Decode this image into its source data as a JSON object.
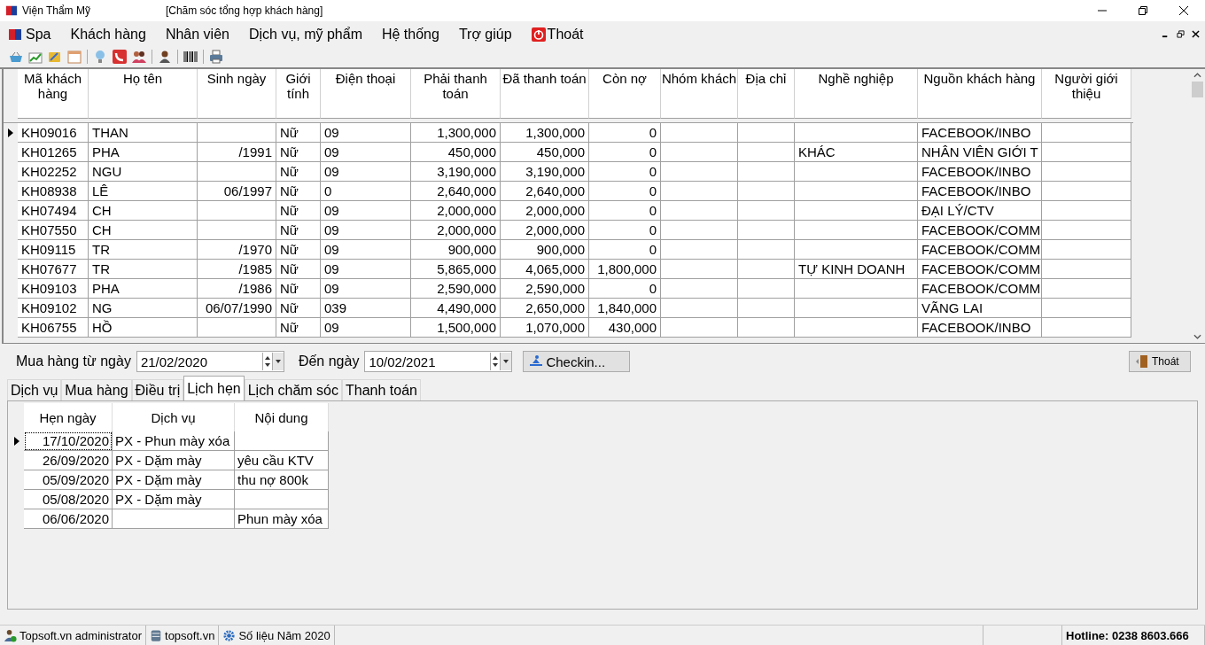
{
  "window": {
    "title": "Viện Thẩm Mỹ",
    "subtitle": "[Chăm sóc tổng hợp khách hàng]"
  },
  "menu": [
    {
      "label": "Spa",
      "kind": "logo"
    },
    {
      "label": "Khách hàng",
      "kind": "plain"
    },
    {
      "label": "Nhân viên",
      "kind": "plain"
    },
    {
      "label": "Dịch vụ, mỹ phẩm",
      "kind": "plain"
    },
    {
      "label": "Hệ thống",
      "kind": "plain"
    },
    {
      "label": "Trợ giúp",
      "kind": "plain"
    },
    {
      "label": "Thoát",
      "kind": "exit"
    }
  ],
  "table": {
    "columns": [
      {
        "label": "Mã khách hàng",
        "kind": "text"
      },
      {
        "label": "Họ tên",
        "kind": "text"
      },
      {
        "label": "Sinh ngày",
        "kind": "number"
      },
      {
        "label": "Giới tính",
        "kind": "text"
      },
      {
        "label": "Điện thoại",
        "kind": "text"
      },
      {
        "label": "Phải thanh toán",
        "kind": "number"
      },
      {
        "label": "Đã thanh toán",
        "kind": "number"
      },
      {
        "label": "Còn nợ",
        "kind": "number"
      },
      {
        "label": "Nhóm khách",
        "kind": "text"
      },
      {
        "label": "Địa chỉ",
        "kind": "text"
      },
      {
        "label": "Nghề nghiệp",
        "kind": "text"
      },
      {
        "label": "Nguồn khách hàng",
        "kind": "text"
      },
      {
        "label": "Người giới thiệu",
        "kind": "text"
      }
    ],
    "rows": [
      {
        "current": true,
        "cells": [
          "KH09016",
          "THAN",
          "",
          "Nữ",
          "09",
          "1,300,000",
          "1,300,000",
          "0",
          "",
          "",
          "",
          "FACEBOOK/INBO",
          ""
        ]
      },
      {
        "current": false,
        "cells": [
          "KH01265",
          "PHA",
          "/1991",
          "Nữ",
          "09",
          "450,000",
          "450,000",
          "0",
          "",
          "",
          "KHÁC",
          "NHÂN VIÊN GIỚI T",
          ""
        ]
      },
      {
        "current": false,
        "cells": [
          "KH02252",
          "NGU",
          "",
          "Nữ",
          "09",
          "3,190,000",
          "3,190,000",
          "0",
          "",
          "",
          "",
          "FACEBOOK/INBO",
          ""
        ]
      },
      {
        "current": false,
        "cells": [
          "KH08938",
          "LÊ",
          "06/1997",
          "Nữ",
          "0",
          "2,640,000",
          "2,640,000",
          "0",
          "",
          "",
          "",
          "FACEBOOK/INBO",
          ""
        ]
      },
      {
        "current": false,
        "cells": [
          "KH07494",
          "CH",
          "",
          "Nữ",
          "09",
          "2,000,000",
          "2,000,000",
          "0",
          "",
          "",
          "",
          "ĐẠI LÝ/CTV",
          ""
        ]
      },
      {
        "current": false,
        "cells": [
          "KH07550",
          "CH",
          "",
          "Nữ",
          "09",
          "2,000,000",
          "2,000,000",
          "0",
          "",
          "",
          "",
          "FACEBOOK/COMM",
          ""
        ]
      },
      {
        "current": false,
        "cells": [
          "KH09115",
          "TR",
          "/1970",
          "Nữ",
          "09",
          "900,000",
          "900,000",
          "0",
          "",
          "",
          "",
          "FACEBOOK/COMM",
          ""
        ]
      },
      {
        "current": false,
        "cells": [
          "KH07677",
          "TR",
          "/1985",
          "Nữ",
          "09",
          "5,865,000",
          "4,065,000",
          "1,800,000",
          "",
          "",
          "TỰ KINH DOANH",
          "FACEBOOK/COMM",
          ""
        ]
      },
      {
        "current": false,
        "cells": [
          "KH09103",
          "PHA",
          "/1986",
          "Nữ",
          "09",
          "2,590,000",
          "2,590,000",
          "0",
          "",
          "",
          "",
          "FACEBOOK/COMM",
          ""
        ]
      },
      {
        "current": false,
        "cells": [
          "KH09102",
          "NG",
          "06/07/1990",
          "Nữ",
          "039",
          "4,490,000",
          "2,650,000",
          "1,840,000",
          "",
          "",
          "",
          "VÃNG LAI",
          ""
        ]
      },
      {
        "current": false,
        "cells": [
          "KH06755",
          "HỒ",
          "",
          "Nữ",
          "09",
          "1,500,000",
          "1,070,000",
          "430,000",
          "",
          "",
          "",
          "FACEBOOK/INBO",
          ""
        ]
      }
    ]
  },
  "date_filter": {
    "from_label": "Mua hàng từ ngày",
    "from_value": "21/02/2020",
    "to_label": "Đến ngày",
    "to_value": "10/02/2021"
  },
  "checkin_button": "Checkin...",
  "exit_button": "Thoát",
  "tabs": [
    {
      "label": "Dịch vụ",
      "selected": false
    },
    {
      "label": "Mua hàng",
      "selected": false
    },
    {
      "label": "Điều trị",
      "selected": false
    },
    {
      "label": "Lịch hẹn",
      "selected": true
    },
    {
      "label": "Lịch chăm sóc",
      "selected": false
    },
    {
      "label": "Thanh toán",
      "selected": false
    }
  ],
  "appointments": {
    "columns": [
      "Hẹn ngày",
      "Dịch vụ",
      "Nội dung"
    ],
    "rows": [
      {
        "current": true,
        "cells": [
          "17/10/2020",
          "PX - Phun mày xóa",
          ""
        ]
      },
      {
        "current": false,
        "cells": [
          "26/09/2020",
          "PX - Dặm mày",
          "yêu cầu KTV"
        ]
      },
      {
        "current": false,
        "cells": [
          "05/09/2020",
          "PX - Dặm mày",
          "thu nợ 800k"
        ]
      },
      {
        "current": false,
        "cells": [
          "05/08/2020",
          "PX - Dặm mày",
          ""
        ]
      },
      {
        "current": false,
        "cells": [
          "06/06/2020",
          "",
          "Phun mày xóa"
        ]
      }
    ]
  },
  "status_bar": [
    {
      "text": "Topsoft.vn administrator",
      "kind": "user"
    },
    {
      "text": "topsoft.vn",
      "kind": "server"
    },
    {
      "text": "Số liệu Năm 2020",
      "kind": "settings"
    },
    {
      "text": "Hotline: 0238 8603.666",
      "kind": "hotline"
    }
  ]
}
